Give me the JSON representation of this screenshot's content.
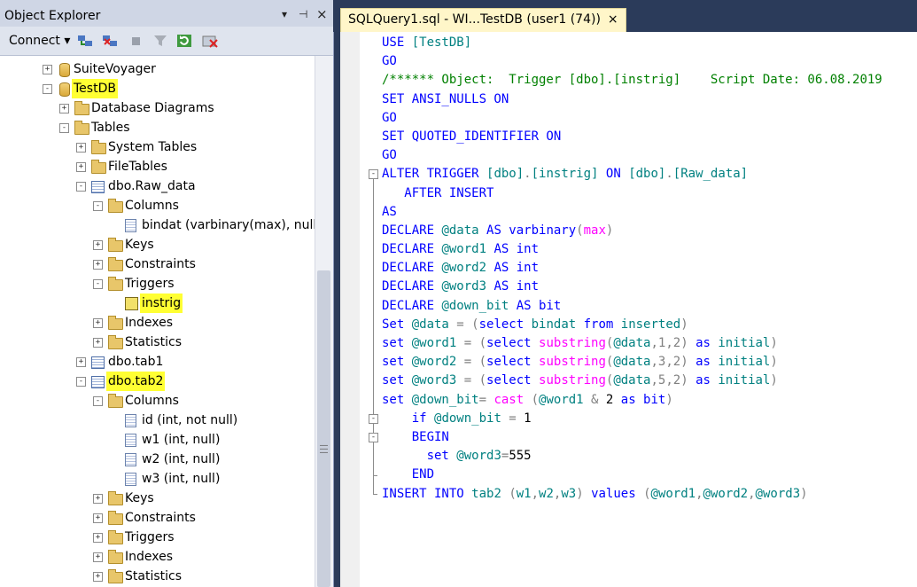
{
  "object_explorer": {
    "title": "Object Explorer",
    "pin_glyph": "▾ ⊣",
    "close_glyph": "×",
    "connect_label": "Connect ▾",
    "toolbar_icons": [
      "connect-object-icon",
      "disconnect-icon",
      "stop-icon",
      "filter-icon",
      "refresh-icon",
      "stop-activity-icon"
    ]
  },
  "tree": [
    {
      "depth": 0,
      "exp": "+",
      "icon": "db",
      "label": "SuiteVoyager",
      "hl": false
    },
    {
      "depth": 0,
      "exp": "−",
      "icon": "db",
      "label": "TestDB",
      "hl": true
    },
    {
      "depth": 1,
      "exp": "+",
      "icon": "folder",
      "label": "Database Diagrams",
      "hl": false
    },
    {
      "depth": 1,
      "exp": "−",
      "icon": "folder",
      "label": "Tables",
      "hl": false
    },
    {
      "depth": 2,
      "exp": "+",
      "icon": "folder",
      "label": "System Tables",
      "hl": false
    },
    {
      "depth": 2,
      "exp": "+",
      "icon": "folder",
      "label": "FileTables",
      "hl": false
    },
    {
      "depth": 2,
      "exp": "−",
      "icon": "tbl",
      "label": "dbo.Raw_data",
      "hl": false
    },
    {
      "depth": 3,
      "exp": "−",
      "icon": "folder",
      "label": "Columns",
      "hl": false
    },
    {
      "depth": 4,
      "exp": "",
      "icon": "col",
      "label": "bindat (varbinary(max), null)",
      "hl": false
    },
    {
      "depth": 3,
      "exp": "+",
      "icon": "folder",
      "label": "Keys",
      "hl": false
    },
    {
      "depth": 3,
      "exp": "+",
      "icon": "folder",
      "label": "Constraints",
      "hl": false
    },
    {
      "depth": 3,
      "exp": "−",
      "icon": "folder",
      "label": "Triggers",
      "hl": false
    },
    {
      "depth": 4,
      "exp": "",
      "icon": "trg",
      "label": "instrig",
      "hl": true
    },
    {
      "depth": 3,
      "exp": "+",
      "icon": "folder",
      "label": "Indexes",
      "hl": false
    },
    {
      "depth": 3,
      "exp": "+",
      "icon": "folder",
      "label": "Statistics",
      "hl": false
    },
    {
      "depth": 2,
      "exp": "+",
      "icon": "tbl",
      "label": "dbo.tab1",
      "hl": false
    },
    {
      "depth": 2,
      "exp": "−",
      "icon": "tbl",
      "label": "dbo.tab2",
      "hl": true
    },
    {
      "depth": 3,
      "exp": "−",
      "icon": "folder",
      "label": "Columns",
      "hl": false
    },
    {
      "depth": 4,
      "exp": "",
      "icon": "col",
      "label": "id (int, not null)",
      "hl": false
    },
    {
      "depth": 4,
      "exp": "",
      "icon": "col",
      "label": "w1 (int, null)",
      "hl": false
    },
    {
      "depth": 4,
      "exp": "",
      "icon": "col",
      "label": "w2 (int, null)",
      "hl": false
    },
    {
      "depth": 4,
      "exp": "",
      "icon": "col",
      "label": "w3 (int, null)",
      "hl": false
    },
    {
      "depth": 3,
      "exp": "+",
      "icon": "folder",
      "label": "Keys",
      "hl": false
    },
    {
      "depth": 3,
      "exp": "+",
      "icon": "folder",
      "label": "Constraints",
      "hl": false
    },
    {
      "depth": 3,
      "exp": "+",
      "icon": "folder",
      "label": "Triggers",
      "hl": false
    },
    {
      "depth": 3,
      "exp": "+",
      "icon": "folder",
      "label": "Indexes",
      "hl": false
    },
    {
      "depth": 3,
      "exp": "+",
      "icon": "folder",
      "label": "Statistics",
      "hl": false
    }
  ],
  "editor": {
    "tab_title": "SQLQuery1.sql - WI...TestDB (user1 (74))",
    "tab_close": "×",
    "lines": [
      [
        [
          "kw",
          "USE "
        ],
        [
          "tl",
          "[TestDB]"
        ]
      ],
      [
        [
          "kw",
          "GO"
        ]
      ],
      [
        [
          "cm",
          "/****** Object:  Trigger [dbo].[instrig]    Script Date: 06.08.2019"
        ]
      ],
      [
        [
          "kw",
          "SET ANSI_NULLS ON"
        ]
      ],
      [
        [
          "kw",
          "GO"
        ]
      ],
      [
        [
          "kw",
          "SET QUOTED_IDENTIFIER ON"
        ]
      ],
      [
        [
          "kw",
          "GO"
        ]
      ],
      [
        [
          "kw",
          "ALTER TRIGGER "
        ],
        [
          "tl",
          "[dbo]"
        ],
        [
          "gr",
          "."
        ],
        [
          "tl",
          "[instrig]"
        ],
        [
          "kw",
          " ON "
        ],
        [
          "tl",
          "[dbo]"
        ],
        [
          "gr",
          "."
        ],
        [
          "tl",
          "[Raw_data]"
        ]
      ],
      [
        [
          "kw",
          "   AFTER INSERT"
        ]
      ],
      [
        [
          "kw",
          "AS"
        ]
      ],
      [
        [
          "kw",
          "DECLARE "
        ],
        [
          "tl",
          "@data"
        ],
        [
          "kw",
          " AS varbinary"
        ],
        [
          "gr",
          "("
        ],
        [
          "fn",
          "max"
        ],
        [
          "gr",
          ")"
        ]
      ],
      [
        [
          "kw",
          "DECLARE "
        ],
        [
          "tl",
          "@word1"
        ],
        [
          "kw",
          " AS int"
        ]
      ],
      [
        [
          "kw",
          "DECLARE "
        ],
        [
          "tl",
          "@word2"
        ],
        [
          "kw",
          " AS int"
        ]
      ],
      [
        [
          "kw",
          "DECLARE "
        ],
        [
          "tl",
          "@word3"
        ],
        [
          "kw",
          " AS int"
        ]
      ],
      [
        [
          "kw",
          "DECLARE "
        ],
        [
          "tl",
          "@down_bit"
        ],
        [
          "kw",
          " AS bit"
        ]
      ],
      [
        [
          "kw",
          "Set "
        ],
        [
          "tl",
          "@data"
        ],
        [
          "gr",
          " = ("
        ],
        [
          "kw",
          "select "
        ],
        [
          "tl",
          "bindat"
        ],
        [
          "kw",
          " from "
        ],
        [
          "tl",
          "inserted"
        ],
        [
          "gr",
          ")"
        ]
      ],
      [
        [
          "kw",
          "set "
        ],
        [
          "tl",
          "@word1"
        ],
        [
          "gr",
          " = ("
        ],
        [
          "kw",
          "select "
        ],
        [
          "fn",
          "substring"
        ],
        [
          "gr",
          "("
        ],
        [
          "tl",
          "@data"
        ],
        [
          "gr",
          ",1,2) "
        ],
        [
          "kw",
          "as "
        ],
        [
          "tl",
          "initial"
        ],
        [
          "gr",
          ")"
        ]
      ],
      [
        [
          "kw",
          "set "
        ],
        [
          "tl",
          "@word2"
        ],
        [
          "gr",
          " = ("
        ],
        [
          "kw",
          "select "
        ],
        [
          "fn",
          "substring"
        ],
        [
          "gr",
          "("
        ],
        [
          "tl",
          "@data"
        ],
        [
          "gr",
          ",3,2) "
        ],
        [
          "kw",
          "as "
        ],
        [
          "tl",
          "initial"
        ],
        [
          "gr",
          ")"
        ]
      ],
      [
        [
          "kw",
          "set "
        ],
        [
          "tl",
          "@word3"
        ],
        [
          "gr",
          " = ("
        ],
        [
          "kw",
          "select "
        ],
        [
          "fn",
          "substring"
        ],
        [
          "gr",
          "("
        ],
        [
          "tl",
          "@data"
        ],
        [
          "gr",
          ",5,2) "
        ],
        [
          "kw",
          "as "
        ],
        [
          "tl",
          "initial"
        ],
        [
          "gr",
          ")"
        ]
      ],
      [
        [
          "kw",
          "set "
        ],
        [
          "tl",
          "@down_bit"
        ],
        [
          "gr",
          "= "
        ],
        [
          "fn",
          "cast "
        ],
        [
          "gr",
          "("
        ],
        [
          "tl",
          "@word1"
        ],
        [
          "gr",
          " & "
        ],
        [
          "tx",
          "2"
        ],
        [
          "kw",
          " as bit"
        ],
        [
          "gr",
          ")"
        ]
      ],
      [
        [
          "kw",
          "    if "
        ],
        [
          "tl",
          "@down_bit"
        ],
        [
          "gr",
          " = "
        ],
        [
          "tx",
          "1"
        ]
      ],
      [
        [
          "kw",
          "    BEGIN"
        ]
      ],
      [
        [
          "kw",
          "      set "
        ],
        [
          "tl",
          "@word3"
        ],
        [
          "gr",
          "="
        ],
        [
          "tx",
          "555"
        ]
      ],
      [
        [
          "kw",
          "    END"
        ]
      ],
      [
        [
          "kw",
          "INSERT INTO "
        ],
        [
          "tl",
          "tab2 "
        ],
        [
          "gr",
          "("
        ],
        [
          "tl",
          "w1"
        ],
        [
          "gr",
          ","
        ],
        [
          "tl",
          "w2"
        ],
        [
          "gr",
          ","
        ],
        [
          "tl",
          "w3"
        ],
        [
          "gr",
          ") "
        ],
        [
          "kw",
          "values "
        ],
        [
          "gr",
          "("
        ],
        [
          "tl",
          "@word1"
        ],
        [
          "gr",
          ","
        ],
        [
          "tl",
          "@word2"
        ],
        [
          "gr",
          ","
        ],
        [
          "tl",
          "@word3"
        ],
        [
          "gr",
          ")"
        ]
      ]
    ]
  }
}
